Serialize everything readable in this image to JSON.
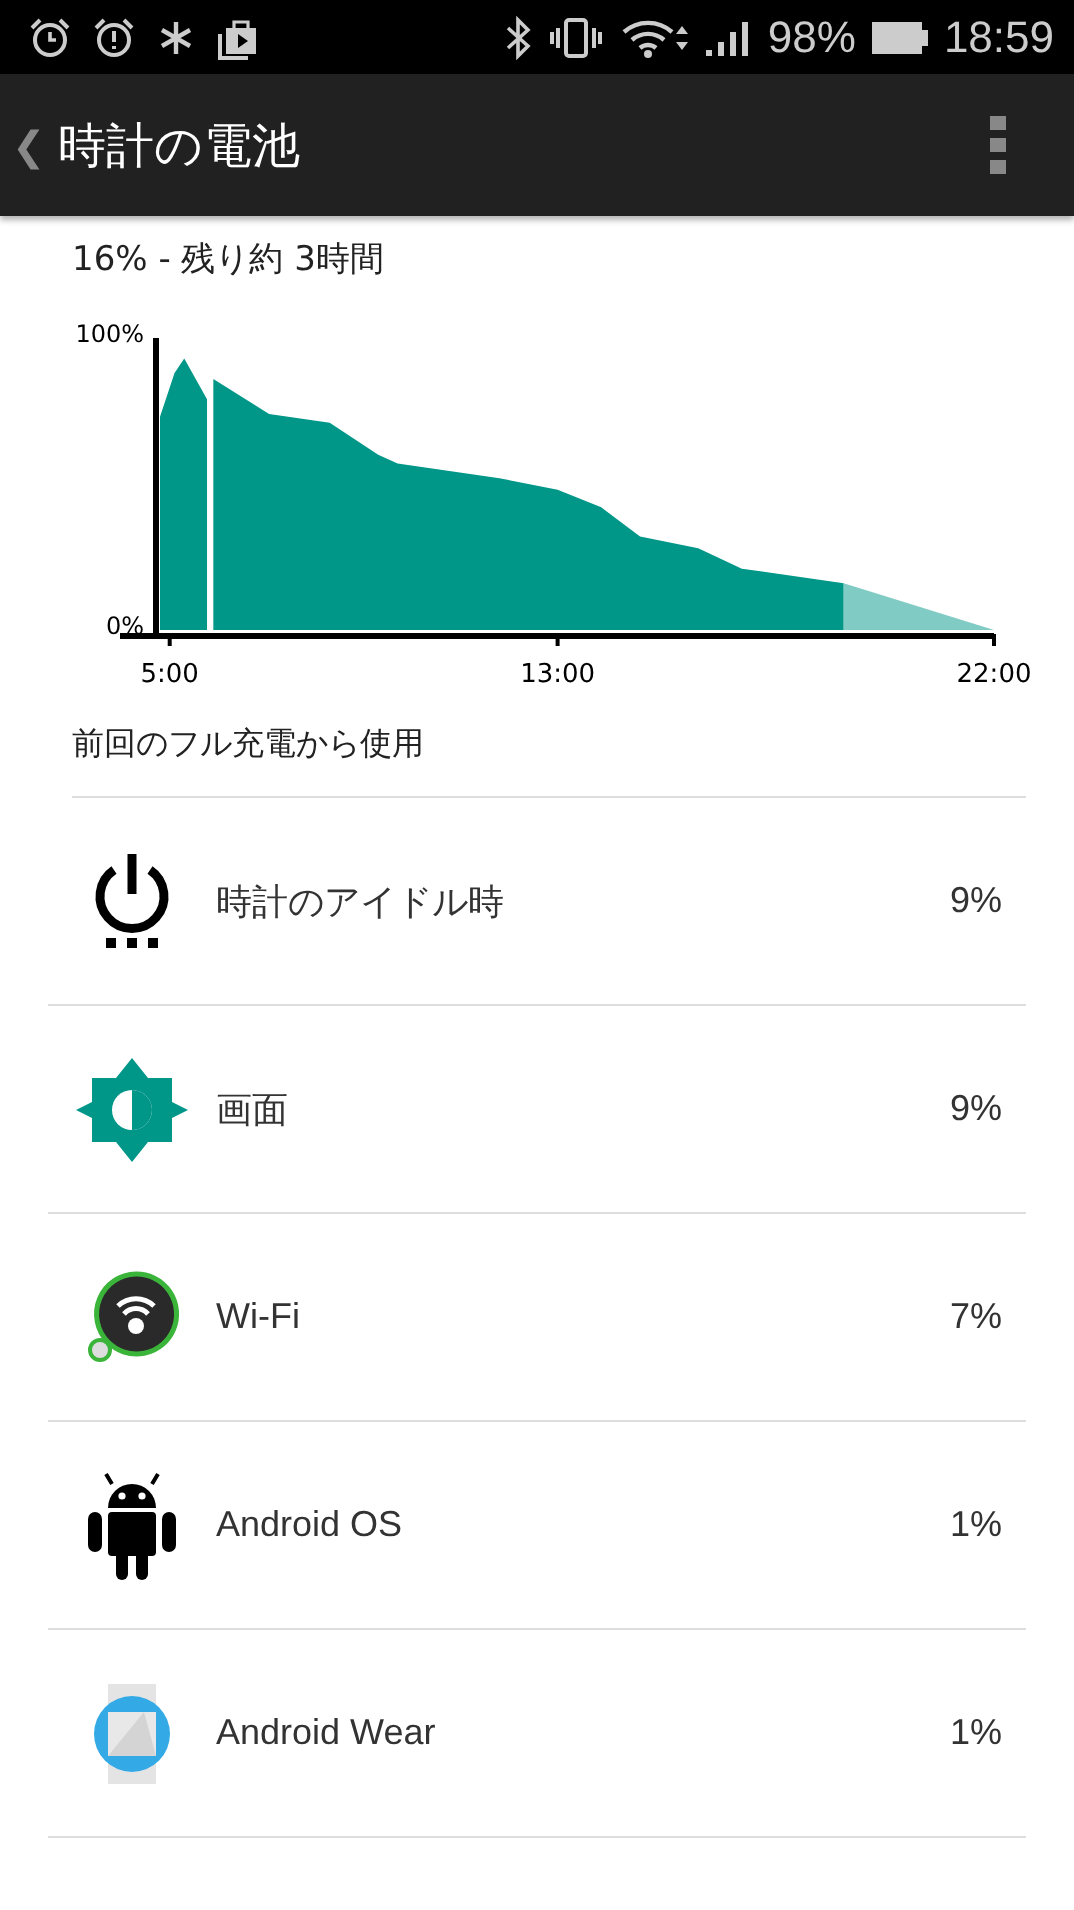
{
  "status_bar": {
    "battery": "98%",
    "time": "18:59"
  },
  "app_bar": {
    "back": "❮",
    "title": "時計の電池"
  },
  "summary": "16% - 残り約 3時間",
  "chart": {
    "chart_data": {
      "type": "area",
      "x": [
        4.8,
        5.1,
        5.3,
        5.8,
        5.85,
        5.9,
        7.05,
        8.3,
        9.3,
        9.7,
        11.8,
        13,
        13.9,
        14.7,
        15.9,
        16.8,
        18.9,
        22
      ],
      "series": [
        {
          "color": "#009688",
          "values": [
            73,
            88,
            93,
            79,
            null,
            86,
            74,
            71,
            60,
            57,
            52,
            48,
            42,
            32,
            28,
            21,
            16,
            null
          ]
        },
        {
          "color": "#80cbc4",
          "values": [
            null,
            null,
            null,
            null,
            null,
            null,
            null,
            null,
            null,
            null,
            null,
            null,
            null,
            null,
            null,
            null,
            16,
            0
          ]
        }
      ],
      "xlim": [
        4.8,
        22
      ],
      "ylim": [
        0,
        100
      ],
      "xticks": [
        {
          "value": 5,
          "label": "5:00"
        },
        {
          "value": 13,
          "label": "13:00"
        },
        {
          "value": 22,
          "label": "22:00"
        }
      ],
      "yticks": [
        {
          "value": 0,
          "label": "0%"
        },
        {
          "value": 100,
          "label": "100%"
        }
      ]
    }
  },
  "section_title": "前回のフル充電から使用",
  "items": [
    {
      "name": "時計のアイドル時",
      "percent": "9%"
    },
    {
      "name": "画面",
      "percent": "9%"
    },
    {
      "name": "Wi-Fi",
      "percent": "7%"
    },
    {
      "name": "Android OS",
      "percent": "1%"
    },
    {
      "name": "Android Wear",
      "percent": "1%"
    }
  ]
}
